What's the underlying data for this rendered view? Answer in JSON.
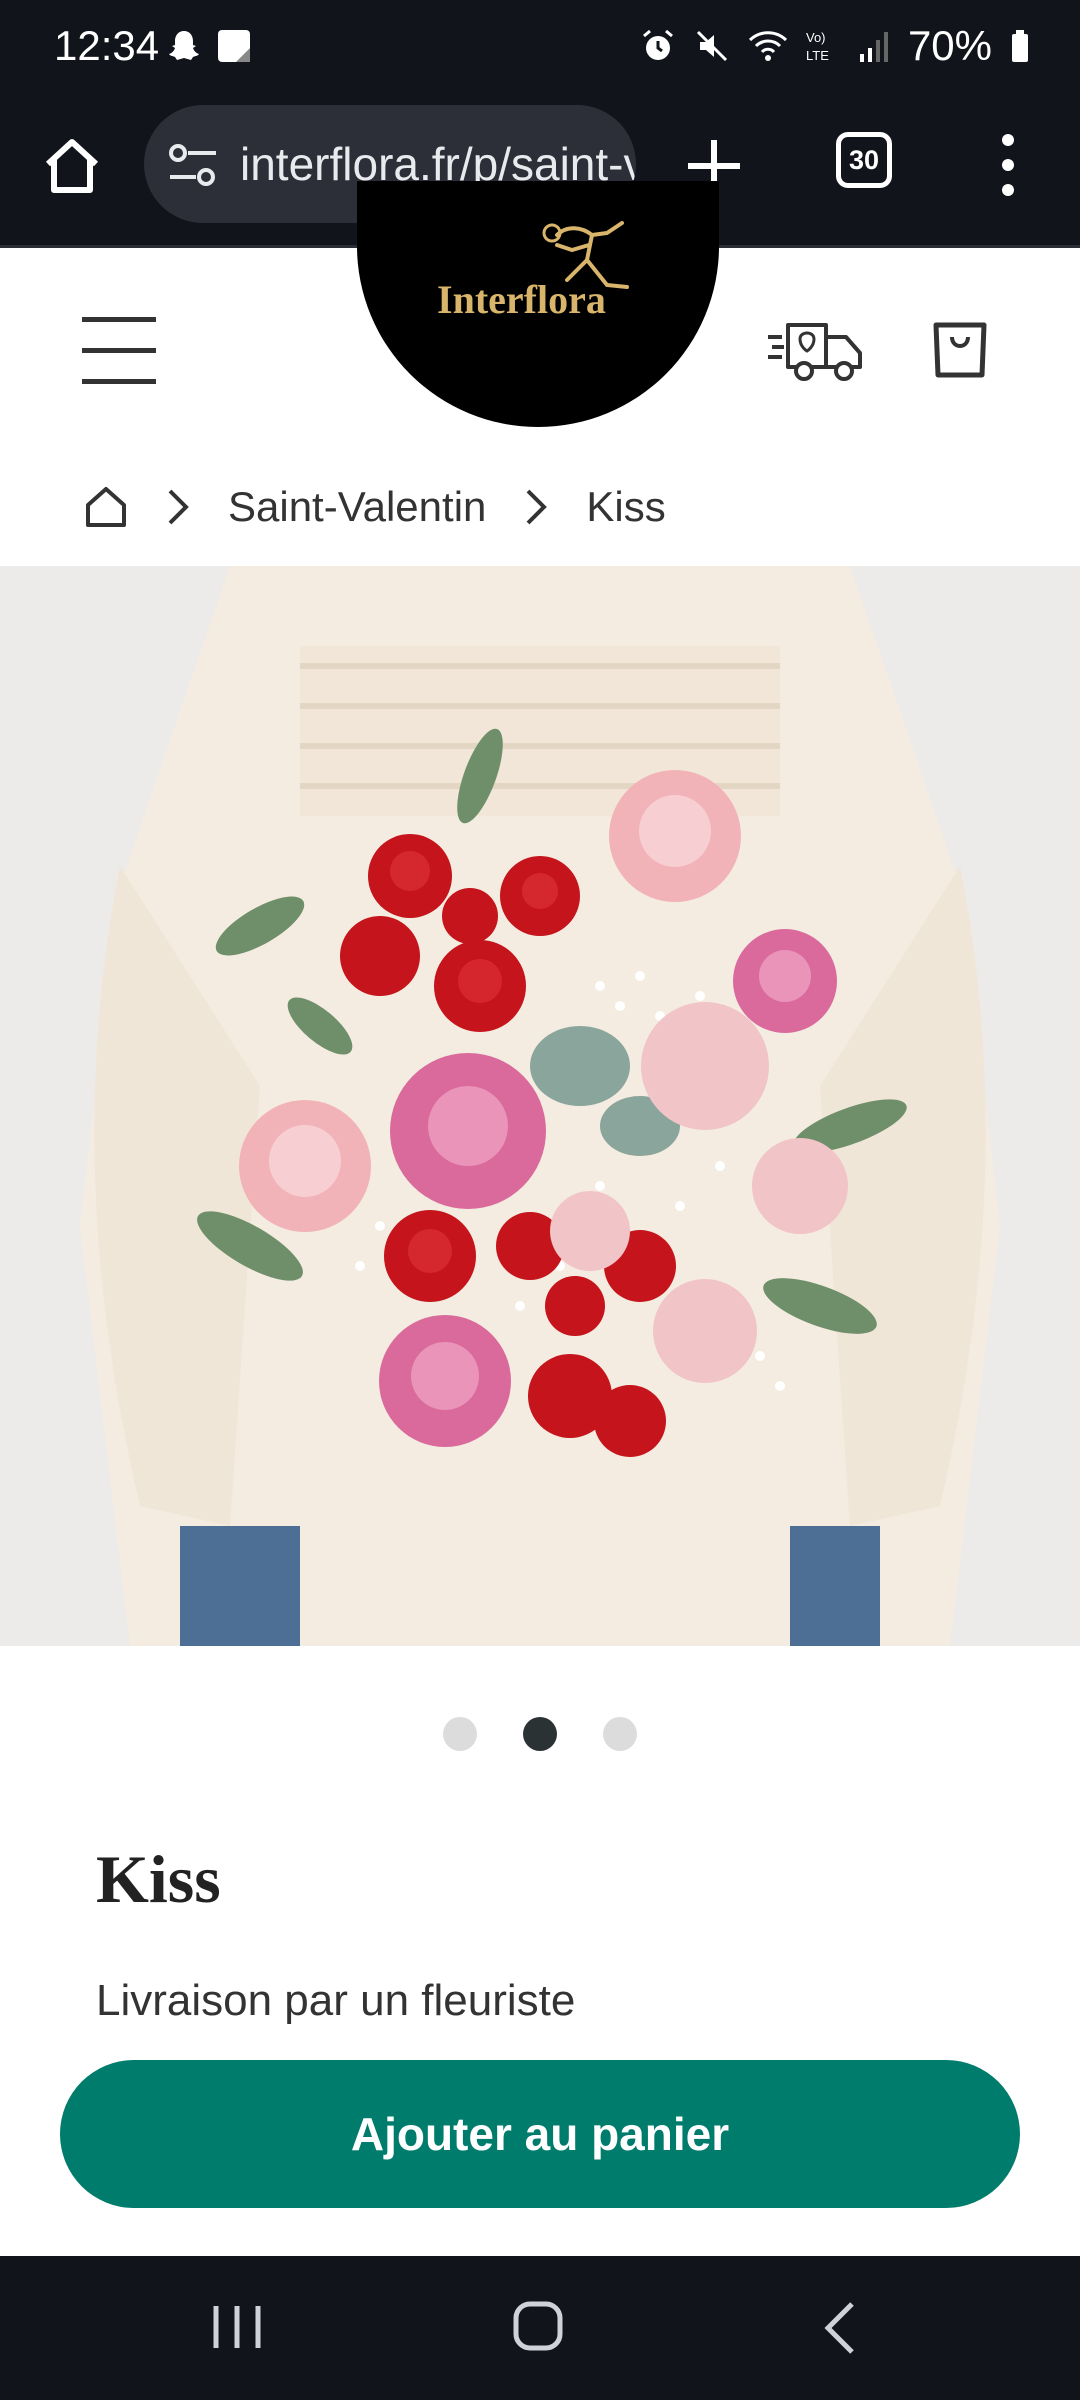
{
  "status": {
    "time": "12:34",
    "battery": "70%"
  },
  "browser": {
    "url": "interflora.fr/p/saint-valentin/kiss",
    "tab_count": "30"
  },
  "header": {
    "logo_text": "Interflora"
  },
  "breadcrumb": {
    "items": [
      "Saint-Valentin",
      "Kiss"
    ]
  },
  "carousel": {
    "slide_count": 3,
    "active_index": 1
  },
  "product": {
    "title": "Kiss",
    "subtitle": "Livraison par un fleuriste",
    "cta_label": "Ajouter au panier"
  },
  "colors": {
    "cta": "#007c6c",
    "system_bar": "#12141c",
    "logo_gold": "#d8b56a"
  },
  "icons": [
    "home-icon",
    "tune-icon",
    "plus-icon",
    "tabs-icon",
    "more-vert-icon",
    "menu-icon",
    "delivery-truck-icon",
    "shopping-bag-icon",
    "chevron-right-icon",
    "recents-icon",
    "nav-home-icon",
    "back-icon"
  ]
}
